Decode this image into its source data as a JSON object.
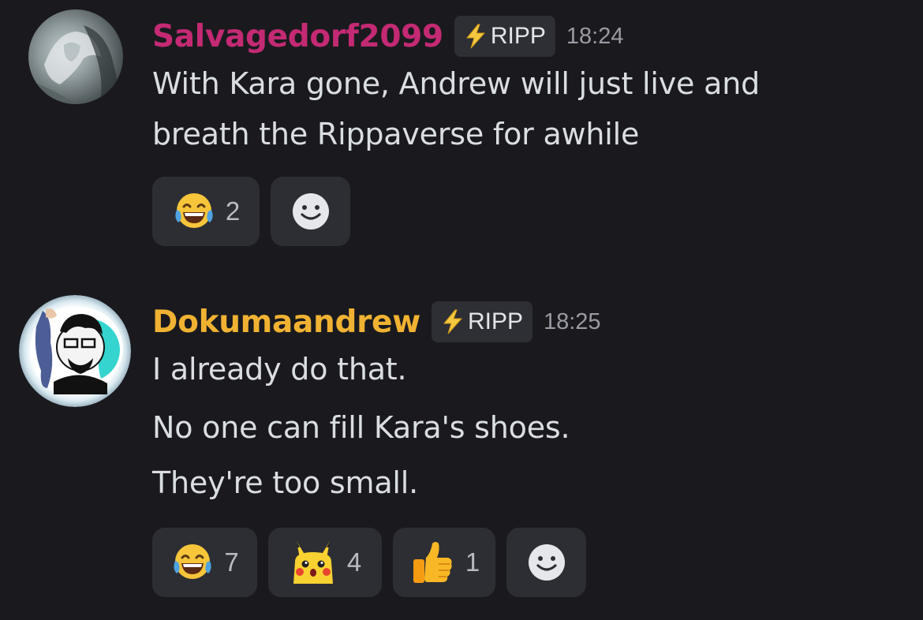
{
  "messages": [
    {
      "username": "Salvagedorf2099",
      "username_color": "#c42a73",
      "tag": "RIPP",
      "tag_icon": "lightning-bolt-icon",
      "timestamp": "18:24",
      "lines": [
        "With Kara gone, Andrew will just live and",
        "breath the Rippaverse for awhile"
      ],
      "reactions": [
        {
          "emoji": "joy-emoji",
          "count": "2"
        },
        {
          "emoji": "add-reaction-icon",
          "count": ""
        }
      ]
    },
    {
      "username": "Dokumaandrew",
      "username_color": "#f0b232",
      "tag": "RIPP",
      "tag_icon": "lightning-bolt-icon",
      "timestamp": "18:25",
      "lines": [
        "I already do that.",
        "No one can fill Kara's shoes.",
        "They're too small."
      ],
      "reactions": [
        {
          "emoji": "joy-emoji",
          "count": "7"
        },
        {
          "emoji": "surprised-pikachu-emoji",
          "count": "4"
        },
        {
          "emoji": "thumbs-up-emoji",
          "count": "1"
        },
        {
          "emoji": "add-reaction-icon",
          "count": ""
        }
      ]
    }
  ],
  "colors": {
    "background": "#1a1a1e",
    "reaction_bg": "#2d2e34",
    "tag_bg": "#2e2f35",
    "timestamp": "#9a9ba3",
    "text": "#dbdee1"
  }
}
